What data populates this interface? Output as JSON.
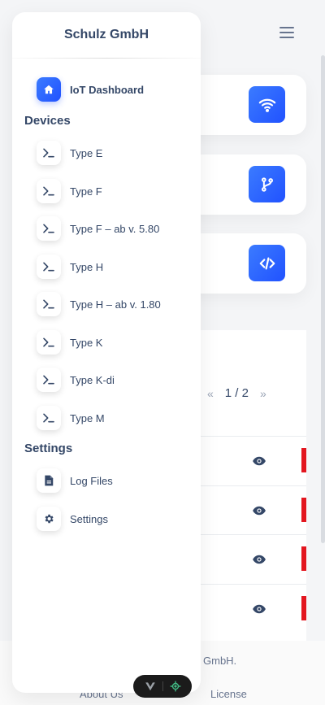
{
  "brand": "Schulz GmbH",
  "sidebar": {
    "dashboard": {
      "label": "IoT Dashboard",
      "icon": "home-icon"
    },
    "devices_title": "Devices",
    "devices": [
      {
        "label": "Type E",
        "icon": "terminal-icon"
      },
      {
        "label": "Type F",
        "icon": "terminal-icon"
      },
      {
        "label": "Type F – ab v. 5.80",
        "icon": "terminal-icon"
      },
      {
        "label": "Type H",
        "icon": "terminal-icon"
      },
      {
        "label": "Type H – ab v. 1.80",
        "icon": "terminal-icon"
      },
      {
        "label": "Type K",
        "icon": "terminal-icon"
      },
      {
        "label": "Type K-di",
        "icon": "terminal-icon"
      },
      {
        "label": "Type M",
        "icon": "terminal-icon"
      }
    ],
    "settings_title": "Settings",
    "settings": [
      {
        "label": "Log Files",
        "icon": "file-icon"
      },
      {
        "label": "Settings",
        "icon": "gear-icon"
      }
    ]
  },
  "background": {
    "cards": [
      {
        "icon": "wifi-icon"
      },
      {
        "icon": "git-branch-icon"
      },
      {
        "icon": "code-icon"
      }
    ],
    "pager": {
      "prev": "«",
      "current": "1 / 2",
      "next": "»"
    },
    "footer_text": "GmbH.",
    "footer_links": [
      "About Us",
      "License"
    ]
  },
  "colors": {
    "accent": "#2152ff",
    "text": "#344767",
    "danger": "#e3161f"
  }
}
